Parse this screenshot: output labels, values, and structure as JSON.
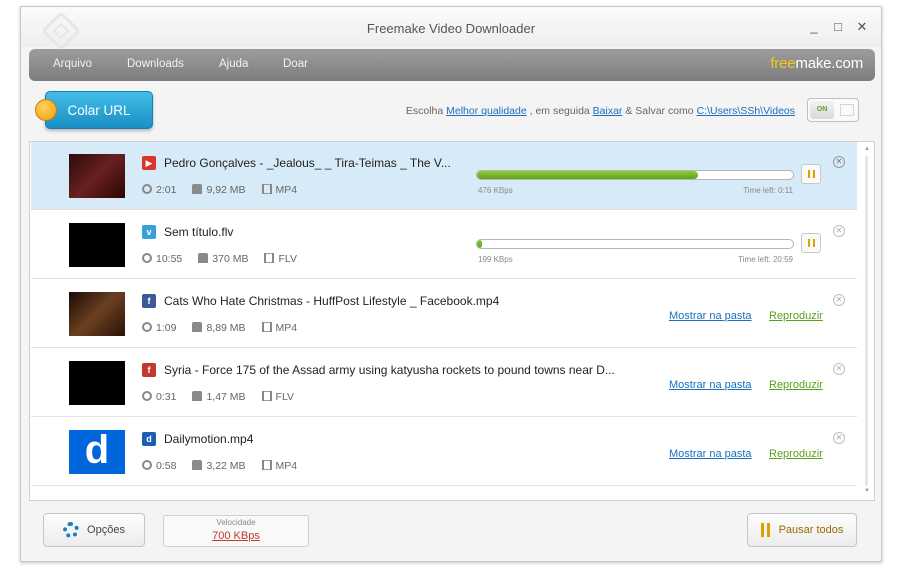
{
  "window": {
    "title": "Freemake Video Downloader",
    "controls": [
      "_",
      "□",
      "✕"
    ]
  },
  "menu": {
    "items": [
      "Arquivo",
      "Downloads",
      "Ajuda",
      "Doar"
    ],
    "brand_accent": "free",
    "brand_rest": "make.com"
  },
  "toolbar": {
    "paste_label": "Colar URL",
    "settings_prefix": "Escolha",
    "quality": "Melhor qualidade",
    "then": ", em seguida",
    "action": "Baixar",
    "save_as": "& Salvar como",
    "path": "C:\\Users\\SSh\\Videos",
    "toggle_label": "ON"
  },
  "downloads": [
    {
      "source_icon": "youtube-icon",
      "name": "Pedro Gonçalves - _Jealous_ _ Tira-Teimas _ The V...",
      "duration": "2:01",
      "size": "9,92 MB",
      "format": "MP4",
      "progress": 0.7,
      "speed": "476 KBps",
      "time_left": "Time left: 0:11",
      "status": "downloading",
      "selected": true
    },
    {
      "source_icon": "vimeo-icon",
      "name": "Sem título.flv",
      "duration": "10:55",
      "size": "370 MB",
      "format": "FLV",
      "progress": 0.01,
      "speed": "199 KBps",
      "time_left": "Time left: 20:59",
      "status": "downloading",
      "selected": false
    },
    {
      "source_icon": "facebook-icon",
      "name": "Cats Who Hate Christmas - HuffPost Lifestyle _ Facebook.mp4",
      "duration": "1:09",
      "size": "8,89 MB",
      "format": "MP4",
      "status": "done",
      "selected": false
    },
    {
      "source_icon": "flash-icon",
      "name": "Syria - Force 175 of the Assad army using katyusha rockets to pound towns near D...",
      "duration": "0:31",
      "size": "1,47 MB",
      "format": "FLV",
      "status": "done",
      "selected": false
    },
    {
      "source_icon": "dailymotion-icon",
      "name": "Dailymotion.mp4",
      "duration": "0:58",
      "size": "3,22 MB",
      "format": "MP4",
      "status": "done",
      "selected": false
    }
  ],
  "actions": {
    "show_folder": "Mostrar na pasta",
    "play": "Reproduzir"
  },
  "footer": {
    "options_label": "Opções",
    "speed_label": "Velocidade",
    "speed_value": "700 KBps",
    "pause_all_label": "Pausar todos"
  },
  "colors": {
    "accent_blue": "#1a8fc3",
    "progress_green": "#6db123",
    "link_blue": "#1a6fbf",
    "play_green": "#5a9f1a",
    "speed_red": "#c0392b",
    "pause_yellow": "#e0a100"
  }
}
